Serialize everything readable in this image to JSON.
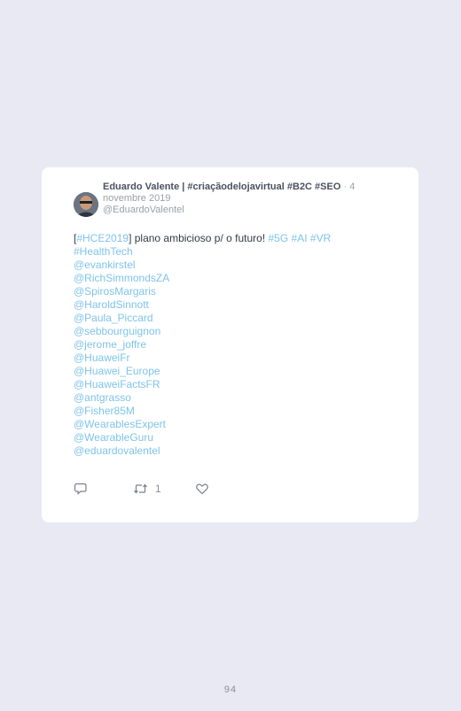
{
  "tweet": {
    "author_name": "Eduardo Valente | #criaçãodelojavirtual #B2C #SEO",
    "separator": "·",
    "date": "4 novembre 2019",
    "handle": "@EduardoValentel",
    "text_open": "[",
    "hashtag_hce": "#HCE2019",
    "text_mid": "] plano ambicioso p/ o futuro! ",
    "hashtag_5g": "#5G",
    "hashtag_ai": "#AI",
    "hashtag_vr": "#VR",
    "hashtag_healthtech": "#HealthTech",
    "mentions": [
      "@evankirstel",
      "@RichSimmondsZA",
      "@SpirosMargaris",
      "@HaroldSinnott",
      "@Paula_Piccard",
      "@sebbourguignon",
      "@jerome_joffre",
      "@HuaweiFr",
      "@Huawei_Europe",
      "@HuaweiFactsFR",
      "@antgrasso",
      "@Fisher85M",
      "@WearablesExpert",
      "@WearableGuru",
      "@eduardovalentel"
    ],
    "retweet_count": "1",
    "icons": [
      "reply-icon",
      "retweet-icon",
      "like-icon"
    ]
  },
  "page_number": "94",
  "colors": {
    "background": "#e8e9f2",
    "card": "#ffffff",
    "link": "#7fc3ea",
    "text": "#333a44"
  }
}
